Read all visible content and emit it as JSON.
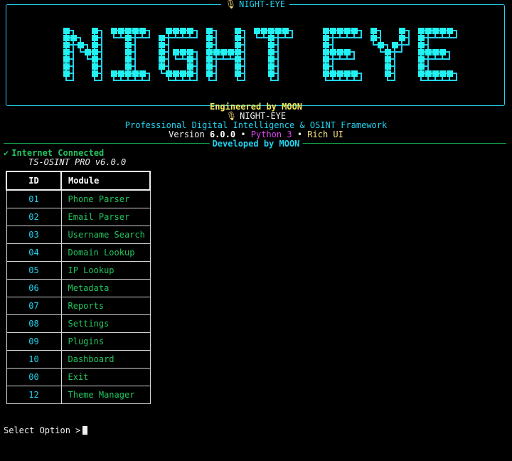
{
  "colors": {
    "background": "#000000",
    "accent_cyan": "#22d3ee",
    "accent_green": "#22c55e",
    "accent_yellow": "#f2ea5a",
    "accent_magenta": "#d946ef",
    "rule_green": "#16a34a"
  },
  "banner": {
    "title_icon": "microphone-icon",
    "title_icon_glyph": "🎙",
    "title": "NIGHT-EYE",
    "logo_text": "NIGHT EYE"
  },
  "info": {
    "engineered": "Engineered by MOON",
    "subtitle_icon": "microphone-icon",
    "subtitle_icon_glyph": "🎙",
    "subtitle": "NIGHT-EYE",
    "framework": "Professional Digital Intelligence & OSINT Framework",
    "version_label": "Version",
    "version": "6.0.0",
    "separator": "•",
    "python": "Python 3",
    "ui": "Rich UI",
    "developed": "Developed by MOON"
  },
  "status": {
    "check_glyph": "✔",
    "internet": "Internet Connected",
    "tool_name": "TS-OSINT PRO v6.0.0"
  },
  "menu": {
    "headers": {
      "id": "ID",
      "module": "Module"
    },
    "rows": [
      {
        "id": "01",
        "module": "Phone Parser"
      },
      {
        "id": "02",
        "module": "Email Parser"
      },
      {
        "id": "03",
        "module": "Username Search"
      },
      {
        "id": "04",
        "module": "Domain Lookup"
      },
      {
        "id": "05",
        "module": "IP Lookup"
      },
      {
        "id": "06",
        "module": "Metadata"
      },
      {
        "id": "07",
        "module": "Reports"
      },
      {
        "id": "08",
        "module": "Settings"
      },
      {
        "id": "09",
        "module": "Plugins"
      },
      {
        "id": "10",
        "module": "Dashboard"
      },
      {
        "id": "00",
        "module": "Exit"
      },
      {
        "id": "12",
        "module": "Theme Manager"
      }
    ]
  },
  "prompt": {
    "label": "Select Option >"
  }
}
